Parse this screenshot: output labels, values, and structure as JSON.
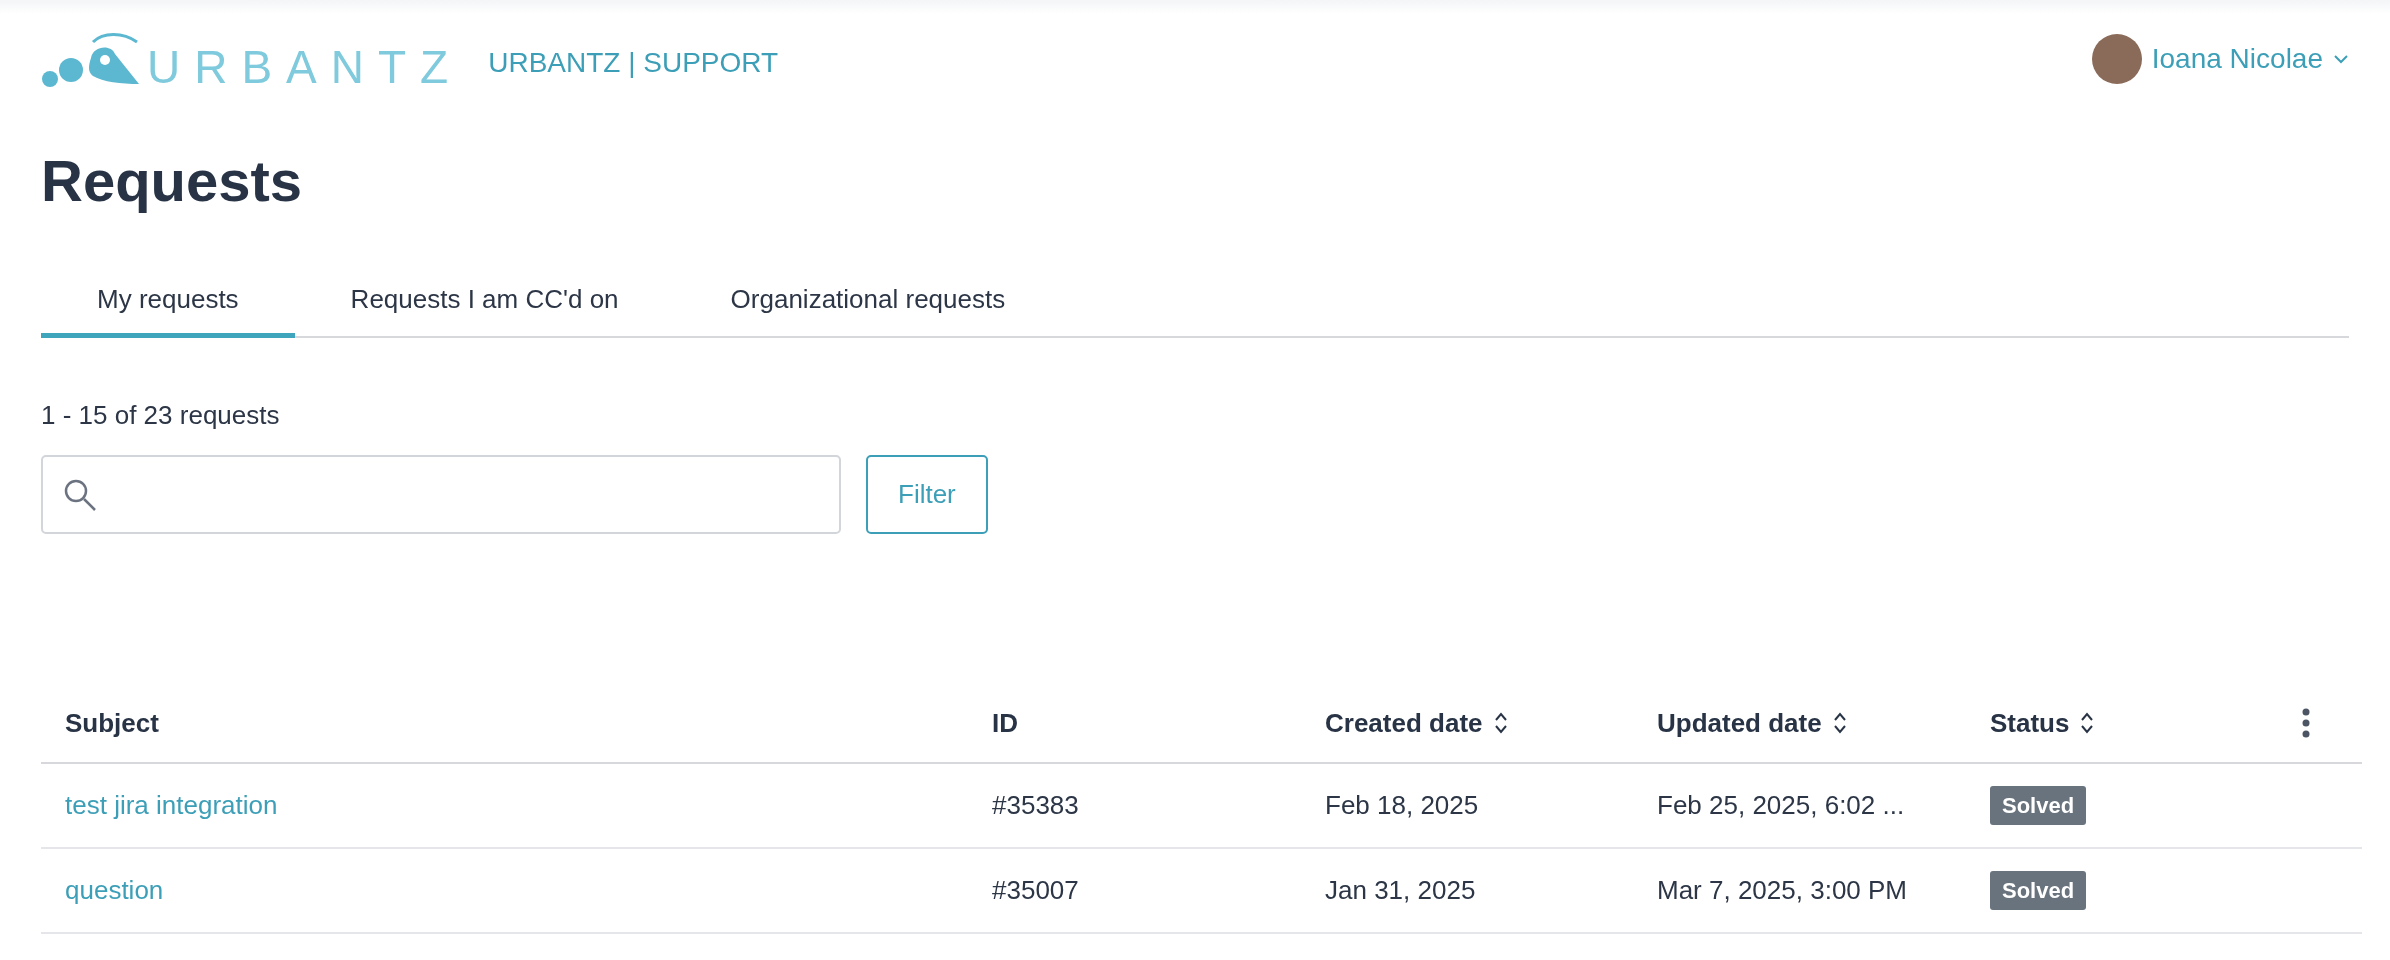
{
  "header": {
    "logo_text": "URBANTZ",
    "brand": "URBANTZ | SUPPORT",
    "user": {
      "name": "Ioana Nicolae"
    }
  },
  "title": "Requests",
  "tabs": [
    {
      "label": "My requests",
      "selected": true
    },
    {
      "label": "Requests I am CC'd on",
      "selected": false
    },
    {
      "label": "Organizational requests",
      "selected": false
    }
  ],
  "count": "1 - 15 of 23 requests",
  "filter_button": "Filter",
  "table": {
    "columns": [
      {
        "label": "Subject",
        "sortable": false
      },
      {
        "label": "ID",
        "sortable": false
      },
      {
        "label": "Created date",
        "sortable": true
      },
      {
        "label": "Updated date",
        "sortable": true
      },
      {
        "label": "Status",
        "sortable": true
      }
    ],
    "rows": [
      {
        "subject": "test jira integration",
        "id": "#35383",
        "created": "Feb 18, 2025",
        "updated": "Feb 25, 2025, 6:02 ...",
        "status": "Solved"
      },
      {
        "subject": "question",
        "id": "#35007",
        "created": "Jan 31, 2025",
        "updated": "Mar 7, 2025, 3:00 PM",
        "status": "Solved"
      }
    ]
  }
}
